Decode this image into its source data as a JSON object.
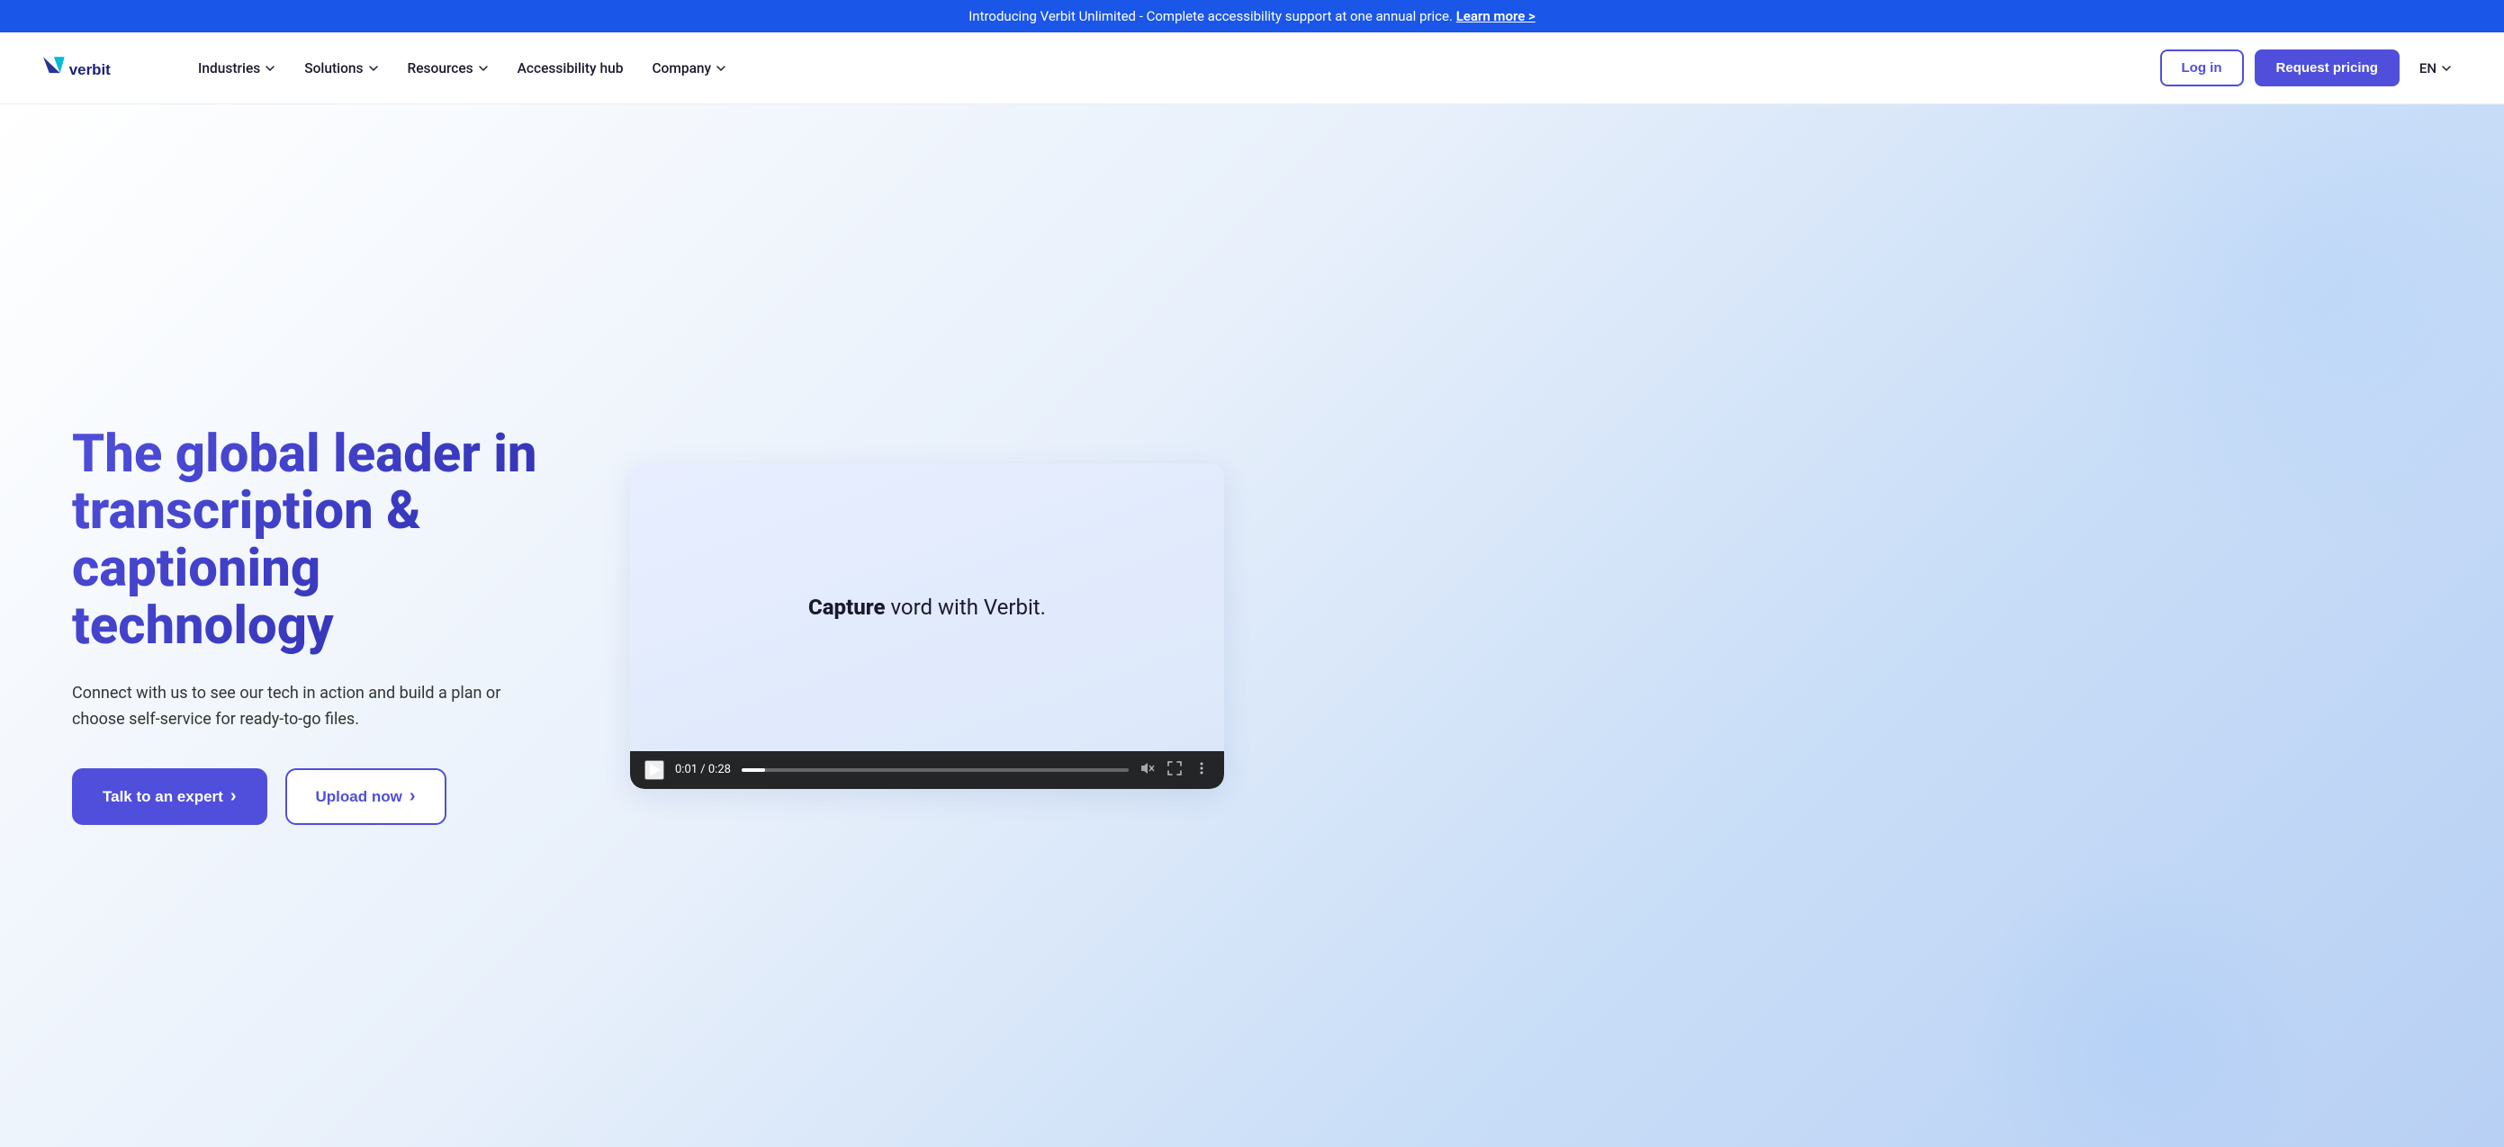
{
  "banner": {
    "text": "Introducing Verbit Unlimited - Complete accessibility support at one annual price.",
    "link_text": "Learn more >"
  },
  "nav": {
    "logo_text": "verbit",
    "items": [
      {
        "label": "Industries",
        "has_dropdown": true
      },
      {
        "label": "Solutions",
        "has_dropdown": true
      },
      {
        "label": "Resources",
        "has_dropdown": true
      },
      {
        "label": "Accessibility hub",
        "has_dropdown": false
      },
      {
        "label": "Company",
        "has_dropdown": true
      }
    ],
    "login_label": "Log in",
    "pricing_label": "Request pricing",
    "lang": "EN"
  },
  "hero": {
    "title": "The global leader in transcription & captioning technology",
    "subtitle": "Connect with us to see our tech in action and build a plan or choose self-service for ready-to-go files.",
    "btn_expert": "Talk to an expert",
    "btn_expert_arrow": "›",
    "btn_upload": "Upload now",
    "btn_upload_arrow": "›"
  },
  "video": {
    "caption_bold": "Capture",
    "caption_rest": " vord with Verbit.",
    "time_current": "0:01",
    "time_total": "0:28",
    "progress_percent": 6
  }
}
